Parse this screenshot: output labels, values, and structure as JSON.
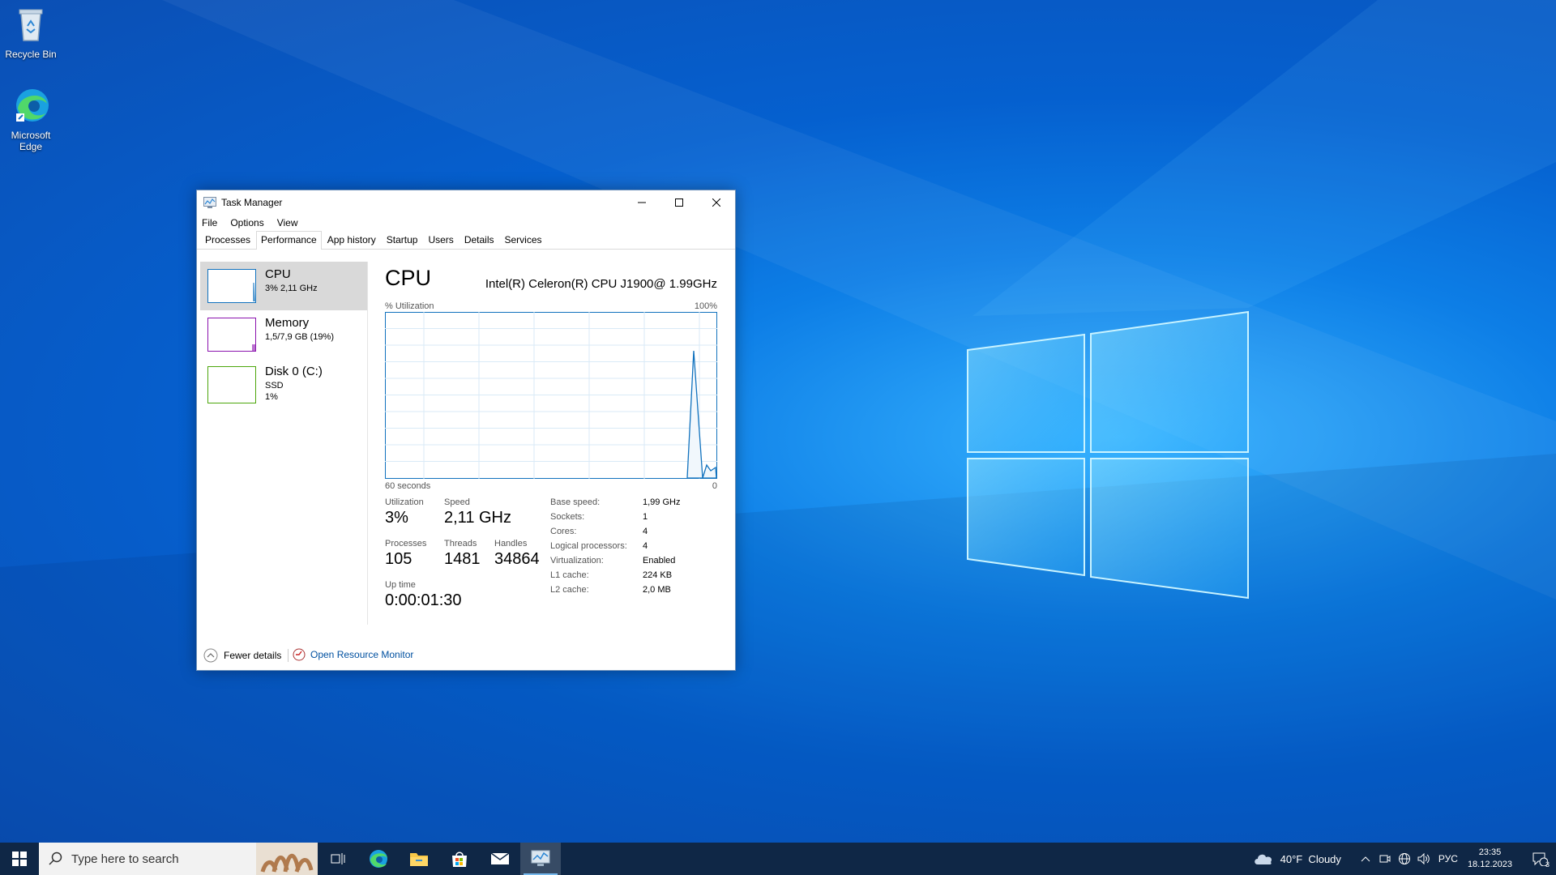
{
  "desktop": {
    "icons": [
      {
        "label": "Recycle Bin"
      },
      {
        "label": "Microsoft Edge"
      }
    ]
  },
  "window": {
    "title": "Task Manager",
    "menu": [
      "File",
      "Options",
      "View"
    ],
    "tabs": [
      "Processes",
      "Performance",
      "App history",
      "Startup",
      "Users",
      "Details",
      "Services"
    ],
    "active_tab": "Performance",
    "resources": [
      {
        "name": "CPU",
        "detail": "3% 2,11 GHz",
        "color": "#1172be"
      },
      {
        "name": "Memory",
        "detail": "1,5/7,9 GB (19%)",
        "color": "#8b12ae"
      },
      {
        "name": "Disk 0 (C:)",
        "detail": "SSD",
        "detail2": "1%",
        "color": "#4da60c"
      }
    ],
    "cpu": {
      "title": "CPU",
      "model": "Intel(R) Celeron(R) CPU J1900@ 1.99GHz",
      "utilization_label": "% Utilization",
      "max_label": "100%",
      "time_label": "60 seconds",
      "min_label": "0",
      "stats": {
        "utilization_label": "Utilization",
        "utilization": "3%",
        "speed_label": "Speed",
        "speed": "2,11 GHz",
        "processes_label": "Processes",
        "processes": "105",
        "threads_label": "Threads",
        "threads": "1481",
        "handles_label": "Handles",
        "handles": "34864",
        "uptime_label": "Up time",
        "uptime": "0:00:01:30"
      },
      "specs": [
        {
          "k": "Base speed:",
          "v": "1,99 GHz"
        },
        {
          "k": "Sockets:",
          "v": "1"
        },
        {
          "k": "Cores:",
          "v": "4"
        },
        {
          "k": "Logical processors:",
          "v": "4"
        },
        {
          "k": "Virtualization:",
          "v": "Enabled"
        },
        {
          "k": "L1 cache:",
          "v": "224 KB"
        },
        {
          "k": "L2 cache:",
          "v": "2,0 MB"
        }
      ]
    },
    "footer": {
      "fewer": "Fewer details",
      "resource_monitor": "Open Resource Monitor"
    }
  },
  "taskbar": {
    "search_placeholder": "Type here to search",
    "weather": "40°F  Cloudy",
    "language": "РУС",
    "time": "23:35",
    "date": "18.12.2023",
    "notifications": "3"
  }
}
